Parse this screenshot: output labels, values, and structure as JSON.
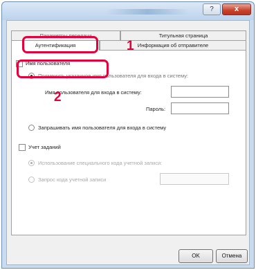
{
  "window": {
    "help_label": "?",
    "close_label": "x"
  },
  "tabs": {
    "row1": [
      "Параметры передачи",
      "Титульная страница"
    ],
    "row2": [
      "Аутентификация",
      "Информация об отправителе"
    ],
    "active": "Аутентификация"
  },
  "auth": {
    "username_checkbox_label": "Имя пользователя",
    "username_checked": true,
    "use_specified_label": "Применить указанное имя пользователя для входа в систему:",
    "login_name_label": "Имя пользователя для входа в систему:",
    "login_name_value": "",
    "password_label": "Пароль:",
    "password_value": "",
    "prompt_label": "Запрашивать имя пользователя для входа в систему"
  },
  "job_accounting": {
    "checkbox_label": "Учет заданий",
    "checked": false,
    "use_specific_code_label": "Использование специального кода учетной записи:",
    "prompt_code_label": "Запрос кода учетной записи",
    "code_value": ""
  },
  "buttons": {
    "ok": "OK",
    "cancel": "Отмена"
  },
  "annotations": {
    "marker1": "1",
    "marker2": "2",
    "highlight_color": "#e4003a"
  }
}
